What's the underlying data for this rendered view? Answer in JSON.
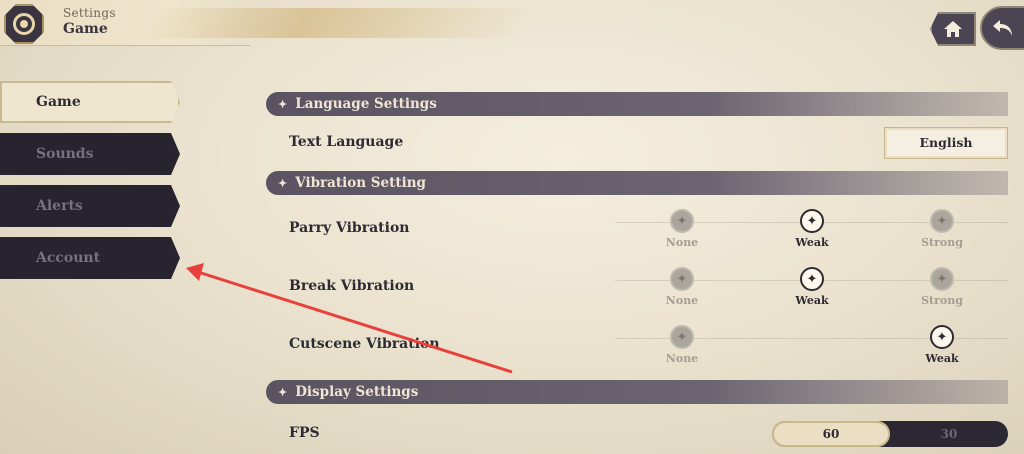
{
  "header": {
    "subtitle": "Settings",
    "title": "Game",
    "icons": {
      "logo": "gear-icon",
      "home": "home-icon",
      "back": "back-arrow-icon"
    }
  },
  "sidebar": {
    "items": [
      {
        "label": "Game",
        "active": true
      },
      {
        "label": "Sounds",
        "active": false
      },
      {
        "label": "Alerts",
        "active": false
      },
      {
        "label": "Account",
        "active": false
      }
    ]
  },
  "sections": {
    "language": {
      "title": "Language Settings"
    },
    "vibration": {
      "title": "Vibration Setting"
    },
    "display": {
      "title": "Display Settings"
    }
  },
  "language": {
    "text_language_label": "Text Language",
    "text_language_value": "English"
  },
  "vibration": {
    "parry": {
      "label": "Parry Vibration",
      "options": [
        "None",
        "Weak",
        "Strong"
      ],
      "selected": "Weak"
    },
    "break": {
      "label": "Break Vibration",
      "options": [
        "None",
        "Weak",
        "Strong"
      ],
      "selected": "Weak"
    },
    "cutscene": {
      "label": "Cutscene Vibration",
      "options": [
        "None",
        "Weak"
      ],
      "selected": "Weak"
    }
  },
  "display": {
    "fps_label": "FPS",
    "fps_options": [
      "60",
      "30"
    ],
    "fps_selected": "60"
  },
  "colors": {
    "dark_panel": "#27242f",
    "cream": "#efe6d0",
    "annotation_arrow": "#e8403a"
  }
}
